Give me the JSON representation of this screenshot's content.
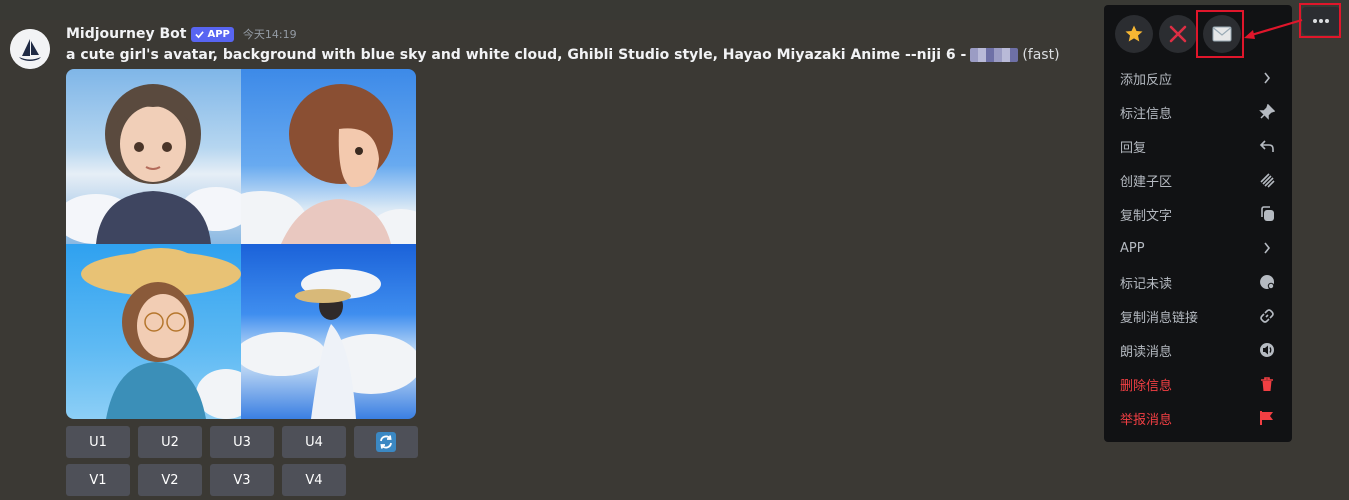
{
  "message": {
    "username": "Midjourney Bot",
    "app_tag": "APP",
    "timestamp": "今天14:19",
    "prompt": "a cute girl's avatar, background with blue sky and white cloud, Ghibli Studio style, Hayao Miyazaki Anime --niji 6 -",
    "speed": "(fast)"
  },
  "buttons": {
    "row1": [
      "U1",
      "U2",
      "U3",
      "U4"
    ],
    "row2": [
      "V1",
      "V2",
      "V3",
      "V4"
    ]
  },
  "context_menu": {
    "items": [
      {
        "label": "添加反应",
        "icon": "chevron-right-icon",
        "danger": false
      },
      {
        "label": "标注信息",
        "icon": "pin-icon",
        "danger": false
      },
      {
        "label": "回复",
        "icon": "reply-icon",
        "danger": false
      },
      {
        "label": "创建子区",
        "icon": "thread-icon",
        "danger": false
      },
      {
        "label": "复制文字",
        "icon": "copy-icon",
        "danger": false
      },
      {
        "label": "APP",
        "icon": "chevron-right-icon",
        "danger": false
      },
      {
        "label": "标记未读",
        "icon": "mark-unread-icon",
        "danger": false
      },
      {
        "label": "复制消息链接",
        "icon": "link-icon",
        "danger": false
      },
      {
        "label": "朗读消息",
        "icon": "speaker-icon",
        "danger": false
      },
      {
        "label": "删除信息",
        "icon": "trash-icon",
        "danger": true
      },
      {
        "label": "举报消息",
        "icon": "flag-icon",
        "danger": true
      }
    ],
    "reactions": [
      "star-icon",
      "x-icon",
      "envelope-icon"
    ]
  },
  "colors": {
    "background": "#3b3934",
    "menu": "#111214",
    "danger": "#f23f43",
    "accent": "#5865f2",
    "highlight": "#e0162b"
  }
}
